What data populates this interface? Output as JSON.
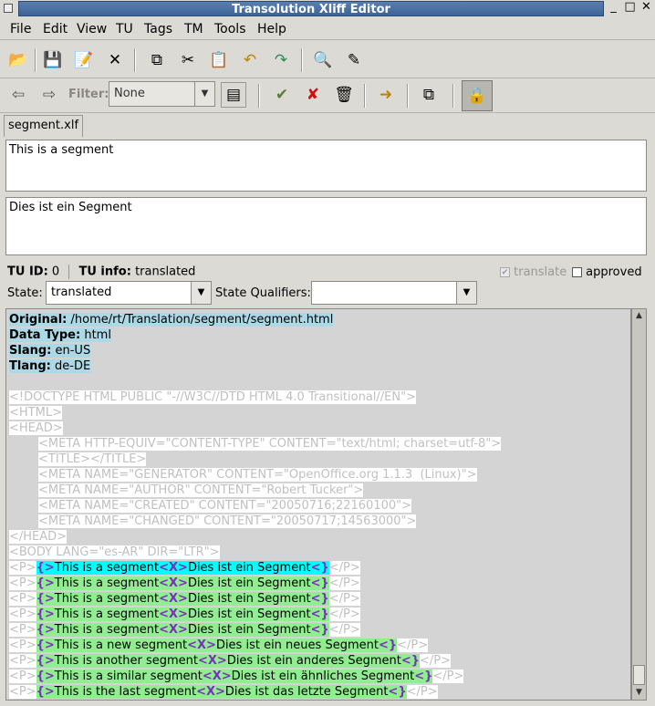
{
  "window": {
    "title": "Transolution Xliff Editor"
  },
  "menu": [
    "File",
    "Edit",
    "View",
    "TU",
    "Tags",
    "TM",
    "Tools",
    "Help"
  ],
  "filter": {
    "label": "Filter:",
    "value": "None"
  },
  "tab": {
    "label": "segment.xlf"
  },
  "source_text": "This is a segment",
  "target_text": "Dies ist ein Segment",
  "tu": {
    "id_label": "TU ID:",
    "id_value": "0",
    "info_label": "TU info:",
    "info_value": "translated",
    "translate_label": "translate",
    "approved_label": "approved"
  },
  "state": {
    "label": "State:",
    "value": "translated",
    "qualifiers_label": "State Qualifiers:",
    "qualifiers_value": ""
  },
  "meta": [
    {
      "label": "Original:",
      "value": "/home/rt/Translation/segment/segment.html"
    },
    {
      "label": "Data Type:",
      "value": "html"
    },
    {
      "label": "Slang:",
      "value": "en-US"
    },
    {
      "label": "Tlang:",
      "value": "de-DE"
    }
  ],
  "markup": [
    "<!DOCTYPE HTML PUBLIC \"-//W3C//DTD HTML 4.0 Transitional//EN\">",
    "<HTML>",
    "<HEAD>",
    "<META HTTP-EQUIV=\"CONTENT-TYPE\" CONTENT=\"text/html; charset=utf-8\">",
    "<TITLE></TITLE>",
    "<META NAME=\"GENERATOR\" CONTENT=\"OpenOffice.org 1.1.3  (Linux)\">",
    "<META NAME=\"AUTHOR\" CONTENT=\"Robert Tucker\">",
    "<META NAME=\"CREATED\" CONTENT=\"20050716;22160100\">",
    "<META NAME=\"CHANGED\" CONTENT=\"20050717;14563000\">",
    "</HEAD>",
    "<BODY LANG=\"es-AR\" DIR=\"LTR\">"
  ],
  "segment_tags": {
    "open_p": "<P>",
    "close_p": "</P>",
    "seg_open": "{>",
    "seg_mid": "<X>",
    "seg_close": "<}"
  },
  "segments": [
    {
      "src": "This is a segment",
      "tgt": "Dies ist ein Segment"
    },
    {
      "src": "This is a segment",
      "tgt": "Dies ist ein Segment"
    },
    {
      "src": "This is a segment",
      "tgt": "Dies ist ein Segment"
    },
    {
      "src": "This is a segment",
      "tgt": "Dies ist ein Segment"
    },
    {
      "src": "This is a segment",
      "tgt": "Dies ist ein Segment"
    },
    {
      "src": "This is a new segment",
      "tgt": "Dies ist ein neues Segment"
    },
    {
      "src": "This is another segment",
      "tgt": "Dies ist ein anderes Segment"
    },
    {
      "src": "This is a similar segment",
      "tgt": "Dies ist ein ähnliches Segment"
    },
    {
      "src": "This is the last segment",
      "tgt": "Dies ist das letzte Segment"
    }
  ]
}
